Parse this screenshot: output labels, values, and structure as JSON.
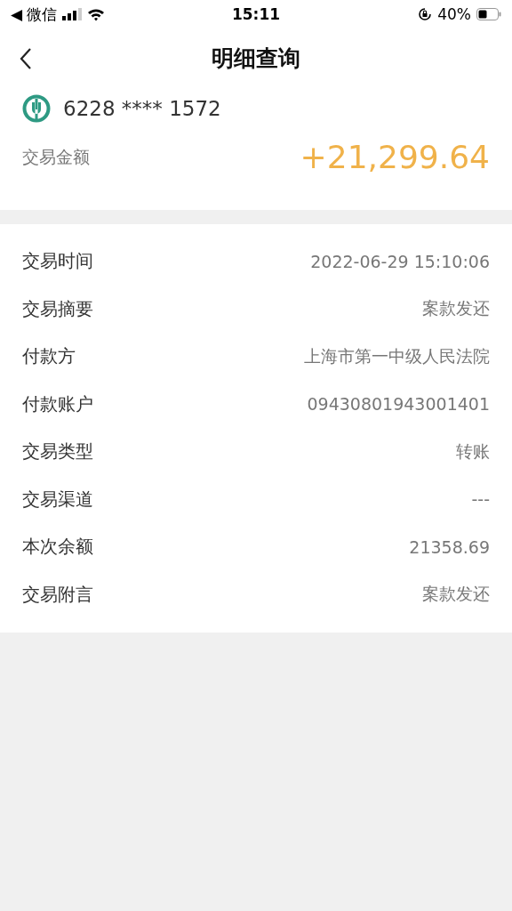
{
  "status_bar": {
    "back_app": "◀ 微信",
    "time": "15:11",
    "battery": "40%"
  },
  "nav": {
    "title": "明细查询"
  },
  "account": {
    "number": "6228 **** 1572",
    "amount_label": "交易金额",
    "amount": "+21,299.64"
  },
  "details": [
    {
      "label": "交易时间",
      "value": "2022-06-29 15:10:06"
    },
    {
      "label": "交易摘要",
      "value": "案款发还"
    },
    {
      "label": "付款方",
      "value": "上海市第一中级人民法院"
    },
    {
      "label": "付款账户",
      "value": "09430801943001401"
    },
    {
      "label": "交易类型",
      "value": "转账"
    },
    {
      "label": "交易渠道",
      "value": "---"
    },
    {
      "label": "本次余额",
      "value": "21358.69"
    },
    {
      "label": "交易附言",
      "value": "案款发还"
    }
  ]
}
